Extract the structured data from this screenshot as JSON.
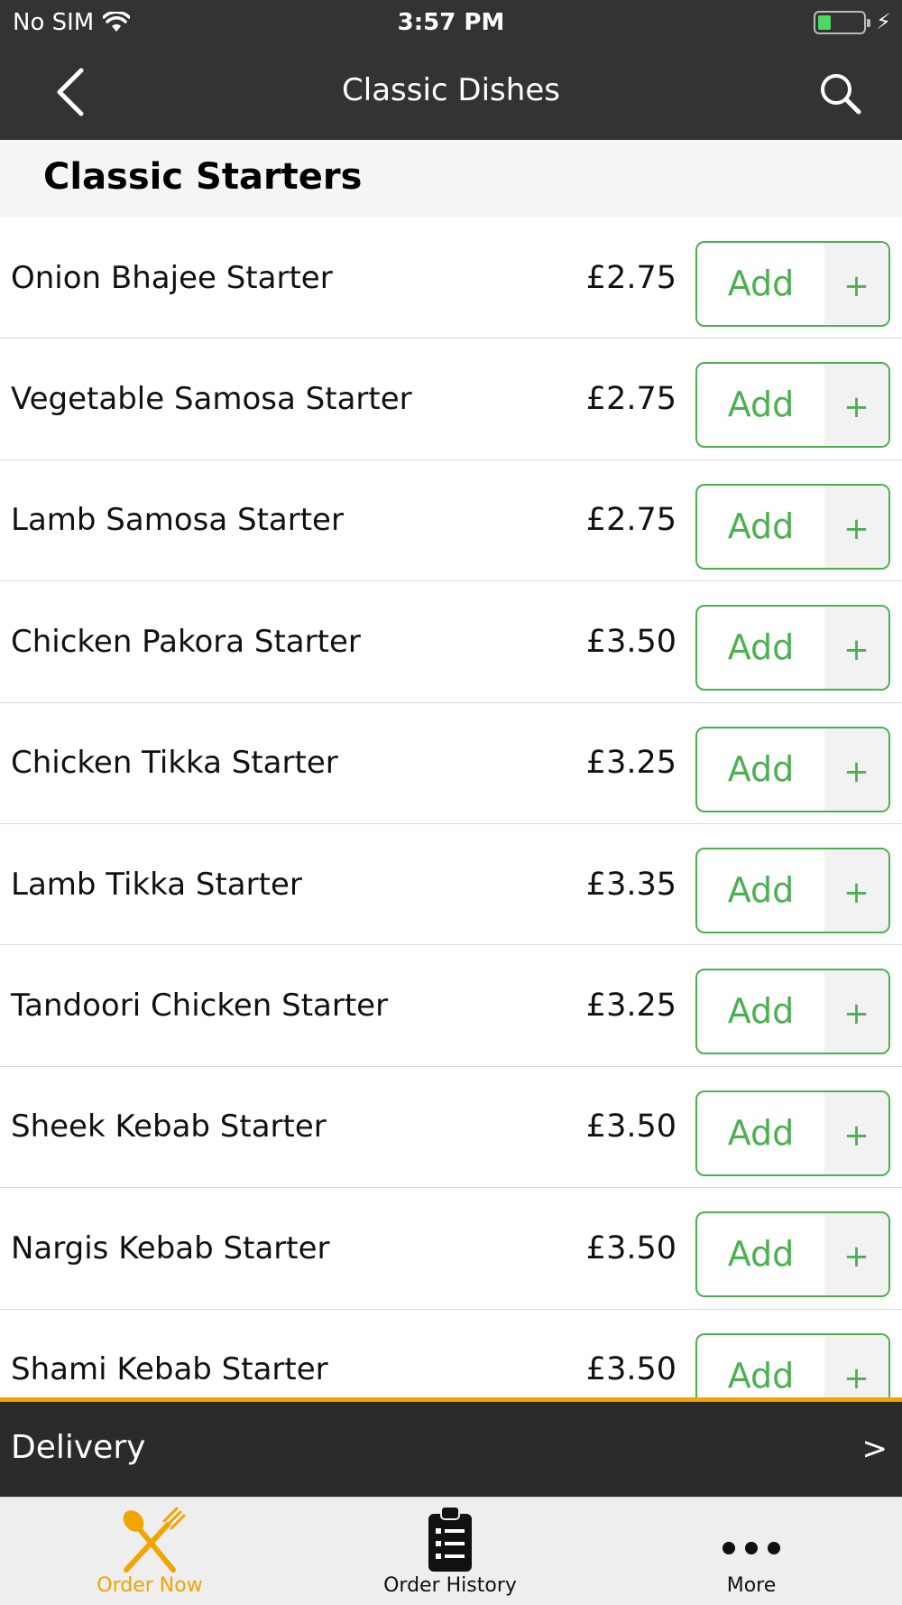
{
  "status_bar": {
    "carrier": "No SIM",
    "time": "3:57 PM"
  },
  "nav": {
    "title": "Classic Dishes"
  },
  "section": {
    "title": "Classic Starters"
  },
  "menu_items": [
    {
      "name": "Onion Bhajee Starter",
      "price": "£2.75",
      "add_label": "Add",
      "plus_label": "+"
    },
    {
      "name": "Vegetable Samosa Starter",
      "price": "£2.75",
      "add_label": "Add",
      "plus_label": "+"
    },
    {
      "name": "Lamb Samosa Starter",
      "price": "£2.75",
      "add_label": "Add",
      "plus_label": "+"
    },
    {
      "name": "Chicken Pakora Starter",
      "price": "£3.50",
      "add_label": "Add",
      "plus_label": "+"
    },
    {
      "name": "Chicken Tikka Starter",
      "price": "£3.25",
      "add_label": "Add",
      "plus_label": "+"
    },
    {
      "name": "Lamb Tikka Starter",
      "price": "£3.35",
      "add_label": "Add",
      "plus_label": "+"
    },
    {
      "name": "Tandoori Chicken Starter",
      "price": "£3.25",
      "add_label": "Add",
      "plus_label": "+"
    },
    {
      "name": "Sheek Kebab Starter",
      "price": "£3.50",
      "add_label": "Add",
      "plus_label": "+"
    },
    {
      "name": "Nargis Kebab Starter",
      "price": "£3.50",
      "add_label": "Add",
      "plus_label": "+"
    },
    {
      "name": "Shami Kebab Starter",
      "price": "£3.50",
      "add_label": "Add",
      "plus_label": "+"
    }
  ],
  "delivery_bar": {
    "label": "Delivery",
    "chevron": ">"
  },
  "tabs": [
    {
      "label": "Order Now",
      "icon": "fork-knife-icon",
      "active": true
    },
    {
      "label": "Order History",
      "icon": "clipboard-icon",
      "active": false
    },
    {
      "label": "More",
      "icon": "more-dots-icon",
      "active": false
    }
  ],
  "colors": {
    "nav_bg": "#333333",
    "accent_orange": "#f0a500",
    "add_green": "#4caf50"
  }
}
